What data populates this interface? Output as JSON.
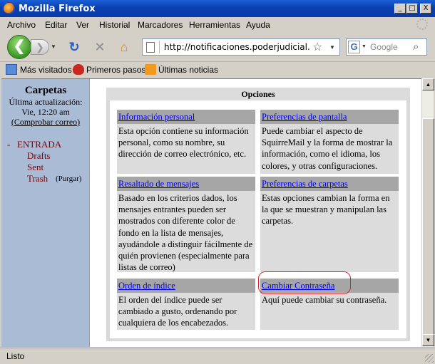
{
  "window": {
    "title": "Mozilla Firefox",
    "min": "_",
    "max": "□",
    "close": "X"
  },
  "menu": [
    "Archivo",
    "Editar",
    "Ver",
    "Historial",
    "Marcadores",
    "Herramientas",
    "Ayuda"
  ],
  "nav": {
    "url": "http://notificaciones.poderjudicial.gub.uy,",
    "search_engine": "G",
    "search_placeholder": "Google"
  },
  "bookmarks": [
    "Más visitados",
    "Primeros pasos",
    "Últimas noticias"
  ],
  "sidebar": {
    "title": "Carpetas",
    "last_update_label": "Última actualización:",
    "last_update_value": "Vie, 12:20 am",
    "check_mail": "(Comprobar correo)",
    "collapse_sign": "-",
    "folders": [
      "ENTRADA",
      "Drafts",
      "Sent",
      "Trash"
    ],
    "purge": "(Purgar)"
  },
  "options": {
    "header": "Opciones",
    "cells": [
      {
        "link": "Información personal",
        "desc": "Esta opción contiene su información personal, como su nombre, su dirección de correo electrónico, etc."
      },
      {
        "link": "Preferencias de pantalla",
        "desc": "Puede cambiar el aspecto de SquirreMail y la forma de mostrar la información, como el idioma, los colores, y otras configuraciones."
      },
      {
        "link": "Resaltado de mensajes",
        "desc": "Basado en los criterios dados, los mensajes entrantes pueden ser mostrados con diferente color de fondo en la lista de mensajes, ayudándole a distinguir fácilmente de quién provienen (especialmente para listas de correo)"
      },
      {
        "link": "Preferencias de carpetas",
        "desc": "Estas opciones cambian la forma en la que se muestran y manipulan las carpetas."
      },
      {
        "link": "Orden de índice",
        "desc": "El orden del índice puede ser cambiado a gusto, ordenando por cualquiera de los encabezados."
      },
      {
        "link": "Cambiar Contraseña",
        "desc": "Aquí puede cambiar su contraseña."
      }
    ]
  },
  "status": "Listo",
  "icons": {
    "back": "back-arrow-icon",
    "forward": "forward-arrow-icon",
    "reload": "reload-icon",
    "stop": "stop-icon",
    "home": "home-icon",
    "star": "bookmark-star-icon",
    "search": "magnifier-icon"
  },
  "colors": {
    "sidebar_bg": "#aabbd6",
    "folder_text": "#800000",
    "link": "#0000ee",
    "highlight": "#d9262a"
  }
}
